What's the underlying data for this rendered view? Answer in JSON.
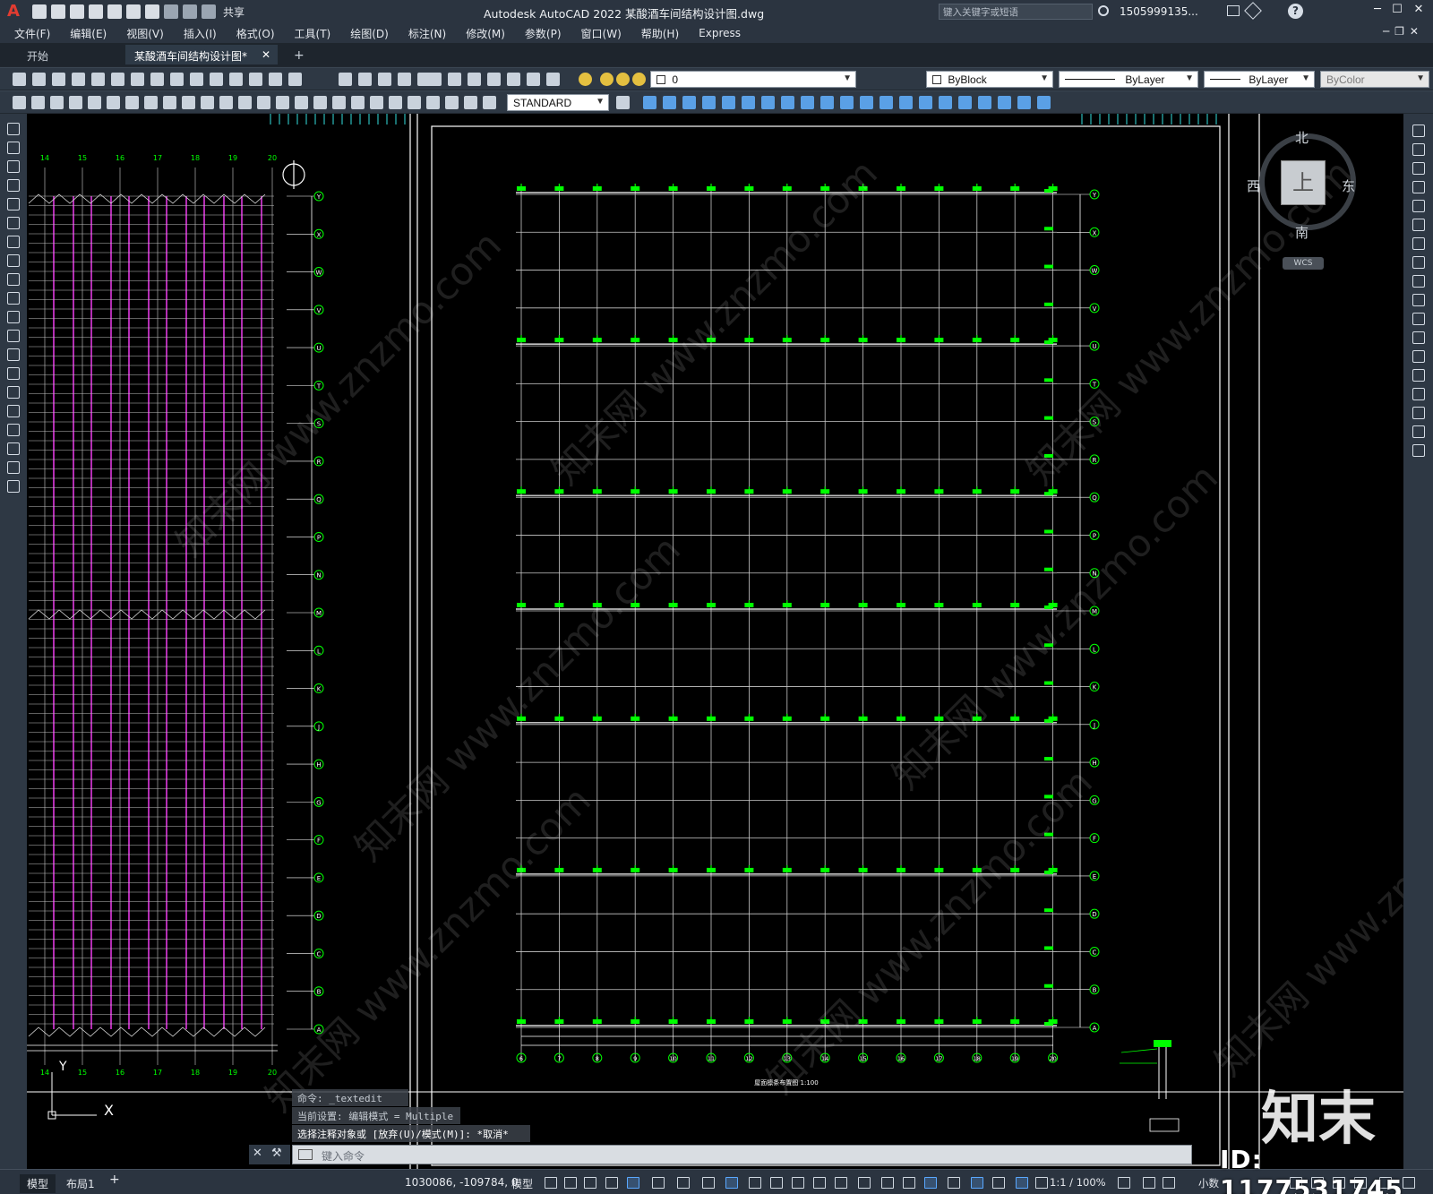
{
  "title_bar": {
    "app_logo": "A",
    "share_label": "共享",
    "app_title": "Autodesk AutoCAD 2022    某酸酒车间结构设计图.dwg",
    "search_placeholder": "键入关键字或短语",
    "user": "1505999135...",
    "help": "?"
  },
  "menu": [
    "文件(F)",
    "编辑(E)",
    "视图(V)",
    "插入(I)",
    "格式(O)",
    "工具(T)",
    "绘图(D)",
    "标注(N)",
    "修改(M)",
    "参数(P)",
    "窗口(W)",
    "帮助(H)",
    "Express"
  ],
  "tabs": {
    "start": "开始",
    "document": "某酸酒车间结构设计图*",
    "close": "✕",
    "add": "+"
  },
  "toolbar": {
    "layer_value": "0",
    "text_style": "STANDARD",
    "color": "ByBlock",
    "linetype": "ByLayer",
    "lineweight": "ByLayer",
    "plotstyle": "ByColor"
  },
  "viewcube": {
    "north": "北",
    "south": "南",
    "east": "东",
    "west": "西",
    "top": "上",
    "wcs": "WCS"
  },
  "command": {
    "lines": [
      "命令: _textedit",
      "当前设置: 编辑模式 = Multiple",
      "选择注释对象或 [放弃(U)/模式(M)]: *取消*"
    ],
    "placeholder": "键入命令"
  },
  "drawing": {
    "left_axis_labels": [
      "Y",
      "X",
      "W",
      "V",
      "U",
      "T",
      "S",
      "R",
      "Q",
      "P",
      "N",
      "M",
      "L",
      "K",
      "J",
      "H",
      "G",
      "F",
      "E",
      "D",
      "C",
      "B",
      "A"
    ],
    "left_bottom_numbers": [
      "14",
      "15",
      "16",
      "17",
      "18",
      "19",
      "20"
    ],
    "right_axis_labels": [
      "Y",
      "X",
      "W",
      "V",
      "U",
      "T",
      "S",
      "R",
      "Q",
      "P",
      "N",
      "M",
      "L",
      "K",
      "J",
      "H",
      "G",
      "F",
      "E",
      "D",
      "C",
      "B",
      "A"
    ],
    "right_bottom_numbers": [
      "6",
      "7",
      "8",
      "9",
      "10",
      "11",
      "12",
      "13",
      "14",
      "15",
      "16",
      "17",
      "18",
      "19",
      "20"
    ],
    "plan_title": "屋面檩条布置图 1:100",
    "ucs_y": "Y",
    "ucs_x": "X"
  },
  "status": {
    "model_tab": "模型",
    "layout_tab": "布局1",
    "add": "+",
    "coords": "1030086, -109784, 0",
    "model_label": "模型",
    "scale": "1:1 / 100%",
    "units": "小数"
  },
  "watermark": {
    "logo": "知末",
    "id": "ID: 1177531745",
    "diag": "知末网 www.znzmo.com"
  },
  "colors": {
    "background": "#000000",
    "chrome": "#2b3440",
    "grid_lines": "#c8c8c8",
    "bolt_green": "#00ff00",
    "magenta": "#ff40ff",
    "accent_blue": "#5aa8ff"
  }
}
